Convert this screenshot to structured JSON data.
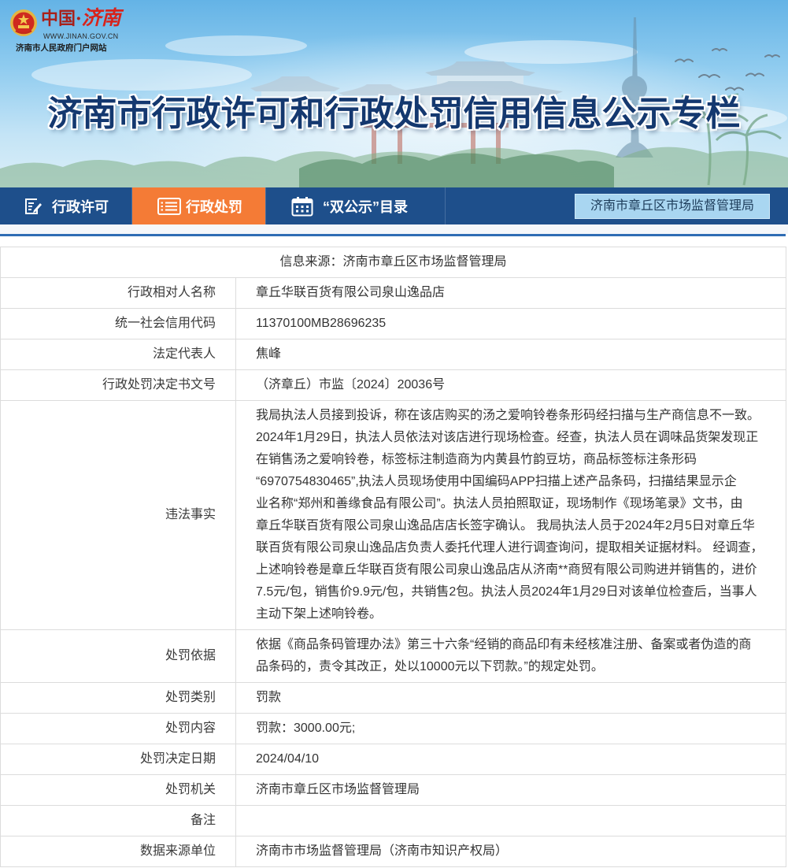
{
  "header": {
    "logo": {
      "emblem_icon": "national-emblem-icon",
      "country": "中国·",
      "city": "济南",
      "url": "WWW.JINAN.GOV.CN",
      "caption": "济南市人民政府门户网站"
    },
    "title": "济南市行政许可和行政处罚信用信息公示专栏"
  },
  "nav": {
    "items": [
      {
        "label": "行政许可",
        "icon": "document-edit-icon",
        "active": false
      },
      {
        "label": "行政处罚",
        "icon": "list-icon",
        "active": true
      },
      {
        "label": "“双公示”目录",
        "icon": "calendar-icon",
        "active": false
      }
    ],
    "department": "济南市章丘区市场监督管理局"
  },
  "record": {
    "source": "信息来源：济南市章丘区市场监督管理局",
    "rows": [
      {
        "label": "行政相对人名称",
        "value": "章丘华联百货有限公司泉山逸品店"
      },
      {
        "label": "统一社会信用代码",
        "value": "11370100MB28696235"
      },
      {
        "label": "法定代表人",
        "value": "焦峰"
      },
      {
        "label": "行政处罚决定书文号",
        "value": "（济章丘）市监〔2024〕20036号"
      },
      {
        "label": "违法事实",
        "lines": [
          "我局执法人员接到投诉，称在该店购买的汤之爱响铃卷条形码经扫描与生产商信息不一致。",
          "2024年1月29日，执法人员依法对该店进行现场检查。经查，执法人员在调味品货架发现正",
          "在销售汤之爱响铃卷，标签标注制造商为内黄县竹韵豆坊，商品标签标注条形码",
          "“6970754830465”,执法人员现场使用中国编码APP扫描上述产品条码，扫描结果显示企",
          "业名称“郑州和善缘食品有限公司”。执法人员拍照取证，现场制作《现场笔录》文书，由",
          "章丘华联百货有限公司泉山逸品店店长签字确认。 我局执法人员于2024年2月5日对章丘华",
          "联百货有限公司泉山逸品店负责人委托代理人进行调查询问，提取相关证据材料。 经调查，",
          "上述响铃卷是章丘华联百货有限公司泉山逸品店从济南**商贸有限公司购进并销售的，进价",
          "7.5元/包，销售价9.9元/包，共销售2包。执法人员2024年1月29日对该单位检查后，当事人",
          "主动下架上述响铃卷。"
        ]
      },
      {
        "label": "处罚依据",
        "lines": [
          "依据《商品条码管理办法》第三十六条“经销的商品印有未经核准注册、备案或者伪造的商",
          "品条码的，责令其改正，处以10000元以下罚款。”的规定处罚。"
        ]
      },
      {
        "label": "处罚类别",
        "value": "罚款"
      },
      {
        "label": "处罚内容",
        "value": "罚款：3000.00元;"
      },
      {
        "label": "处罚决定日期",
        "value": "2024/04/10"
      },
      {
        "label": "处罚机关",
        "value": "济南市章丘区市场监督管理局"
      },
      {
        "label": "备注",
        "value": ""
      },
      {
        "label": "数据来源单位",
        "value": "济南市市场监督管理局（济南市知识产权局）"
      }
    ]
  },
  "colors": {
    "nav_bg": "#1e4f8b",
    "nav_active": "#f47b36",
    "title": "#14386f",
    "department_bg": "#a9d6f1",
    "accent_line": "#2e6cb4"
  }
}
